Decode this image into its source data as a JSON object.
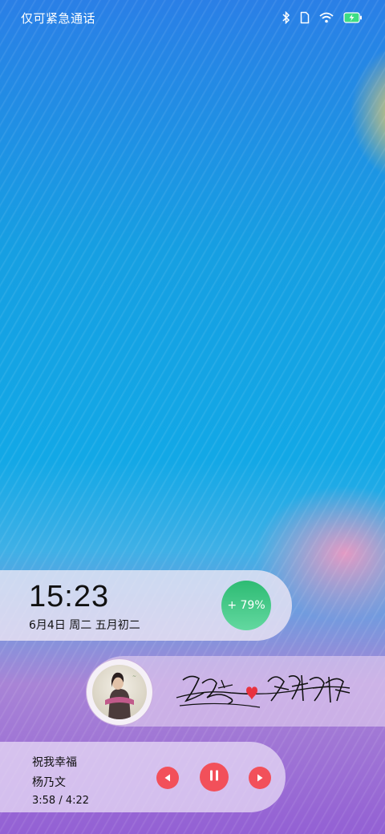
{
  "status_bar": {
    "carrier_text": "仅可紧急通话",
    "icons": [
      "bluetooth-icon",
      "sim-icon",
      "wifi-icon",
      "battery-charging-icon"
    ]
  },
  "clock_widget": {
    "time": "15:23",
    "date": "6月4日  周二  五月初二",
    "battery_label": "+ 79%",
    "battery_level": 0.79
  },
  "signature_widget": {
    "album_cover_icon": "album-cover-photo",
    "signature_icon": "handwritten-signature-with-heart"
  },
  "music_widget": {
    "title": "祝我幸福",
    "artist": "杨乃文",
    "progress_text": "3:58 / 4:22",
    "controls": {
      "prev_icon": "previous-icon",
      "pause_icon": "pause-icon",
      "next_icon": "next-icon"
    }
  },
  "colors": {
    "accent_red": "#f2505a",
    "battery_green": "#2dbb73",
    "heart_red": "#e8323f"
  }
}
